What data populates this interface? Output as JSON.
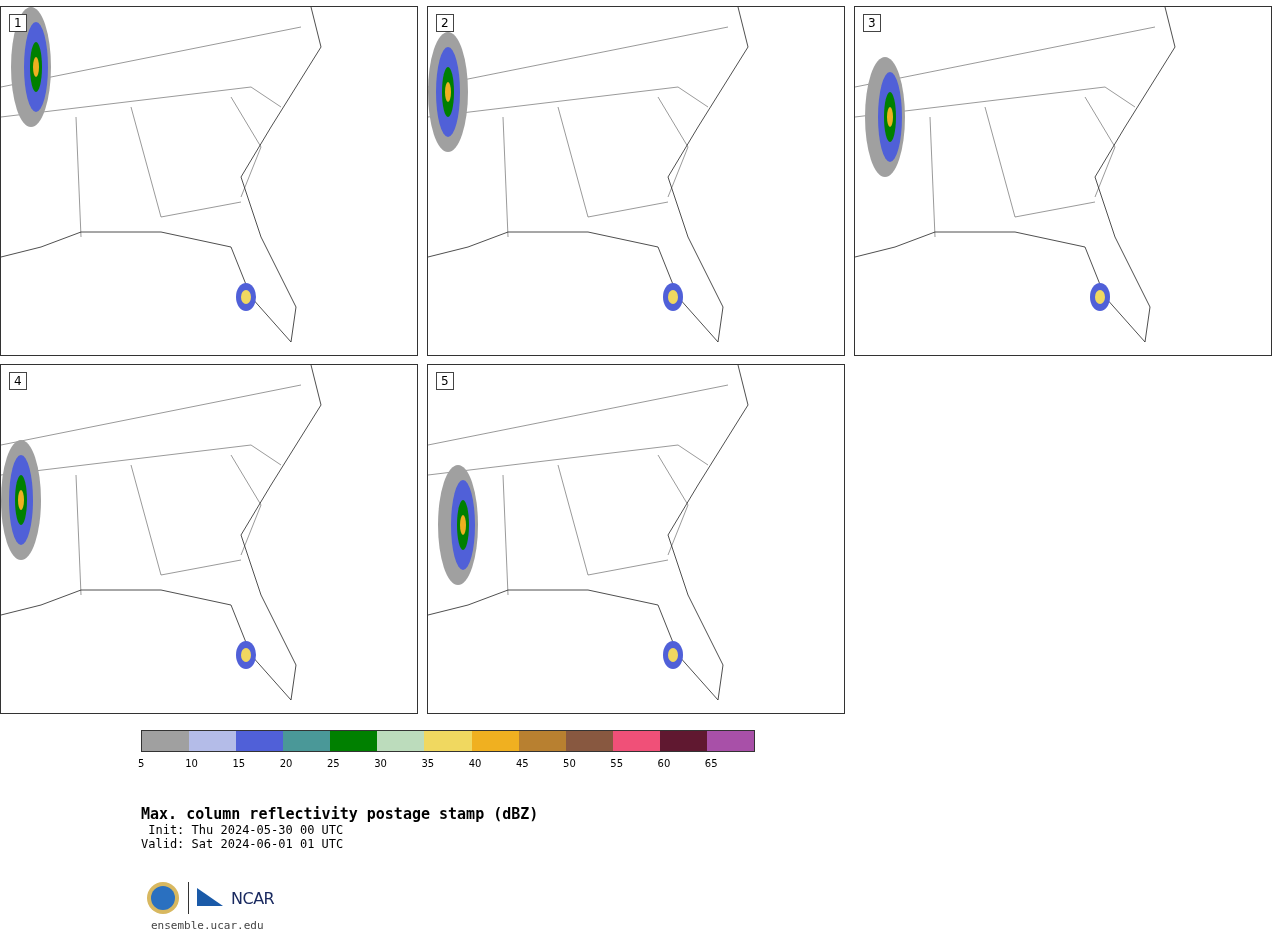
{
  "panels": [
    {
      "label": "1"
    },
    {
      "label": "2"
    },
    {
      "label": "3"
    },
    {
      "label": "4"
    },
    {
      "label": "5"
    }
  ],
  "colorbar": {
    "segments": [
      {
        "color": "#a0a0a0"
      },
      {
        "color": "#b4bce8"
      },
      {
        "color": "#5060d8"
      },
      {
        "color": "#4a9898"
      },
      {
        "color": "#008000"
      },
      {
        "color": "#bcdcbc"
      },
      {
        "color": "#f0d860"
      },
      {
        "color": "#f0b020"
      },
      {
        "color": "#b88030"
      },
      {
        "color": "#885840"
      },
      {
        "color": "#f05078"
      },
      {
        "color": "#601830"
      },
      {
        "color": "#a850a8"
      }
    ],
    "ticks": [
      "5",
      "10",
      "15",
      "20",
      "25",
      "30",
      "35",
      "40",
      "45",
      "50",
      "55",
      "60",
      "65"
    ]
  },
  "title": "Max. column reflectivity postage stamp (dBZ)",
  "init": " Init: Thu 2024-05-30 00 UTC",
  "valid": "Valid: Sat 2024-06-01 01 UTC",
  "logo": {
    "text": "NCAR"
  },
  "url": "ensemble.ucar.edu"
}
